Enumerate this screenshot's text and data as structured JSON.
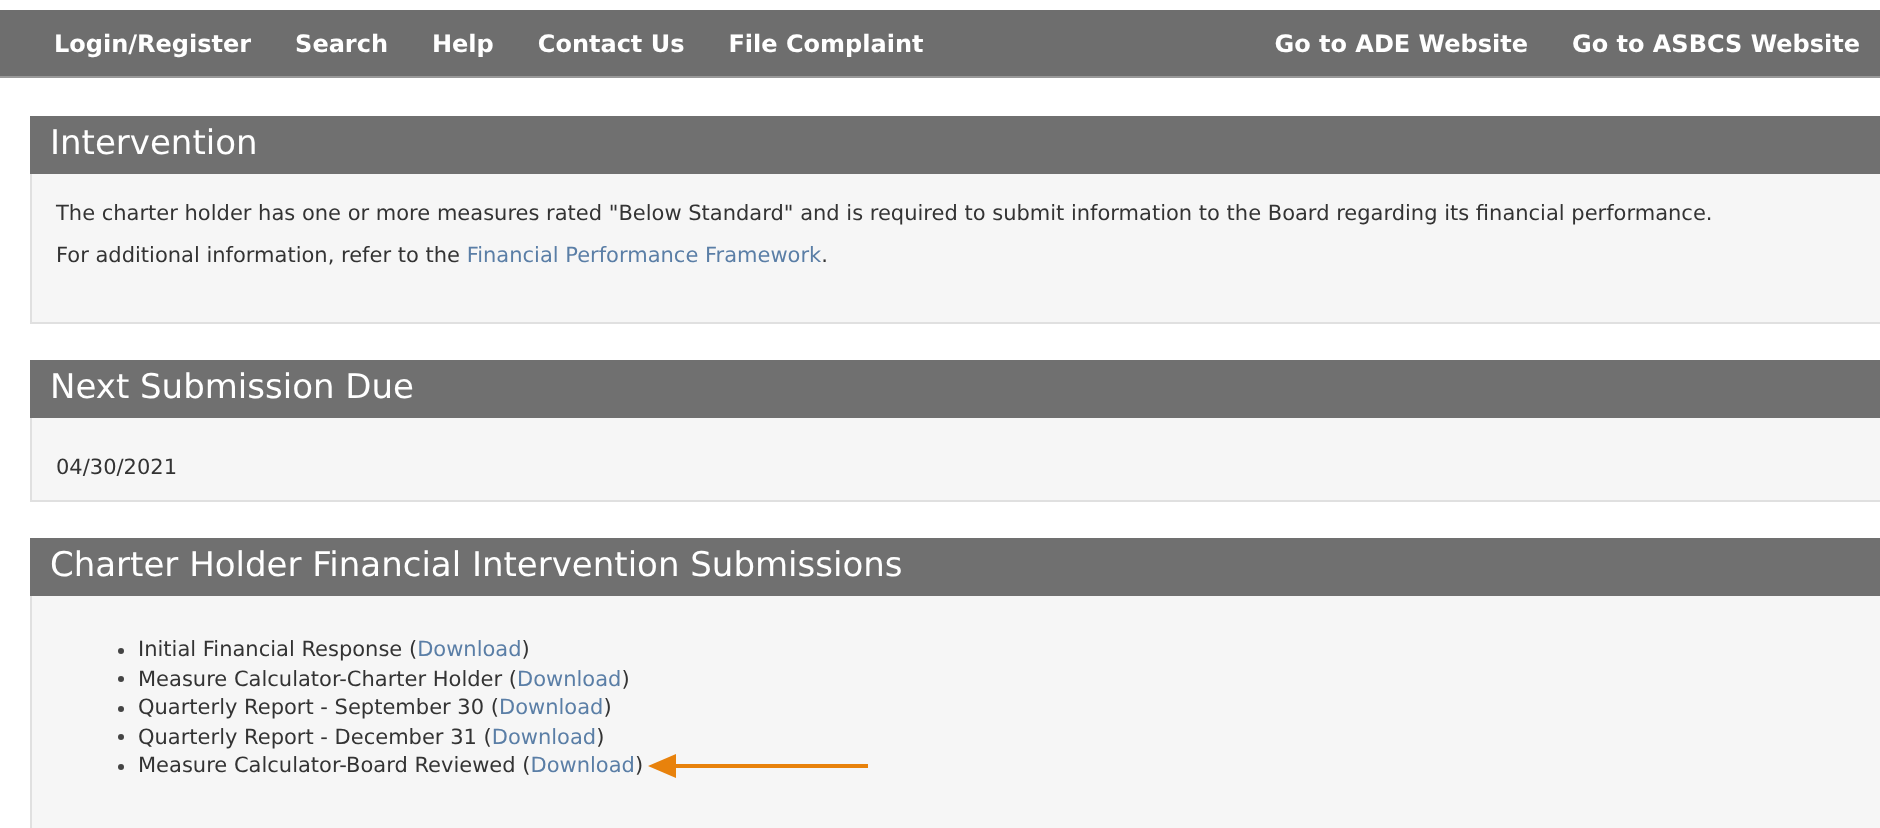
{
  "nav": {
    "left": [
      "Login/Register",
      "Search",
      "Help",
      "Contact Us",
      "File Complaint"
    ],
    "right": [
      "Go to ADE Website",
      "Go to ASBCS Website"
    ]
  },
  "intervention": {
    "title": "Intervention",
    "text": "The charter holder has one or more measures rated \"Below Standard\" and is required to submit information to the Board regarding its financial performance.",
    "ref_prefix": "For additional information, refer to the ",
    "ref_link": "Financial Performance Framework",
    "ref_suffix": "."
  },
  "next_due": {
    "title": "Next Submission Due",
    "date": "04/30/2021"
  },
  "submissions": {
    "title": "Charter Holder Financial Intervention Submissions",
    "items": [
      {
        "label": "Initial Financial Response (",
        "link": "Download",
        "close": ")",
        "highlighted": false
      },
      {
        "label": "Measure Calculator-Charter Holder (",
        "link": "Download",
        "close": ")",
        "highlighted": false
      },
      {
        "label": "Quarterly Report - September 30 (",
        "link": "Download",
        "close": ")",
        "highlighted": false
      },
      {
        "label": "Quarterly Report - December 31 (",
        "link": "Download",
        "close": ")",
        "highlighted": false
      },
      {
        "label": "Measure Calculator-Board Reviewed (",
        "link": "Download",
        "close": ")",
        "highlighted": true
      }
    ]
  }
}
